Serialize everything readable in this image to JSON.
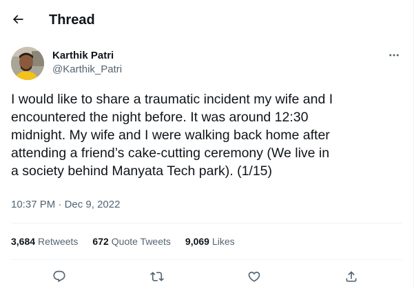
{
  "header": {
    "title": "Thread",
    "back_icon": "arrow-left-icon"
  },
  "tweet": {
    "author": {
      "name": "Karthik Patri",
      "handle": "@Karthik_Patri",
      "avatar_icon": "avatar"
    },
    "text": "I would like to share a traumatic incident my wife and I\nencountered the night before. It was around 12:30\nmidnight. My wife and I were walking back home after\nattending a friend’s cake-cutting ceremony (We live in\na society behind Manyata Tech park). (1/15)",
    "time": "10:37 PM",
    "separator": "·",
    "date": "Dec 9, 2022",
    "stats": {
      "retweets": {
        "count": "3,684",
        "label": "Retweets"
      },
      "quote_tweets": {
        "count": "672",
        "label": "Quote Tweets"
      },
      "likes": {
        "count": "9,069",
        "label": "Likes"
      }
    },
    "actions": [
      "reply-icon",
      "retweet-icon",
      "like-icon",
      "share-icon"
    ]
  },
  "colors": {
    "text_primary": "#0f1419",
    "text_secondary": "#536471",
    "divider": "#eff3f4",
    "background": "#ffffff"
  }
}
